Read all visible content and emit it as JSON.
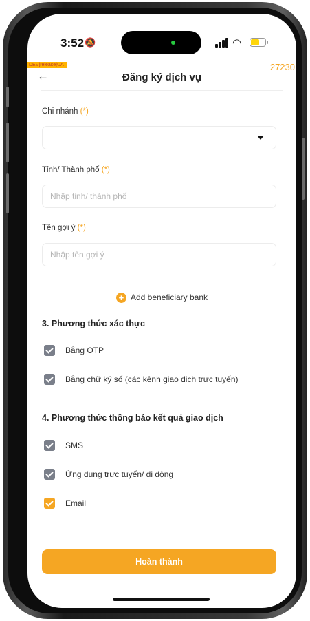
{
  "status": {
    "time": "3:52",
    "bell_icon": "bell-slash-icon",
    "battery_color": "#ffd60a"
  },
  "dev_tag": "DEV|release|UAT",
  "build": "27230",
  "header": {
    "title": "Đăng ký dịch vụ",
    "back_icon": "arrow-left-icon"
  },
  "form": {
    "branch_label": "Chi nhánh",
    "branch_req": "(*)",
    "province_label": "Tỉnh/ Thành phố",
    "province_req": "(*)",
    "province_placeholder": "Nhập tỉnh/ thành phố",
    "suggest_label": "Tên gợi ý",
    "suggest_req": "(*)",
    "suggest_placeholder": "Nhập tên gợi ý"
  },
  "add_bank": "Add beneficiary bank",
  "auth_section": {
    "title": "3. Phương thức xác thực",
    "options": [
      "Bằng OTP",
      "Bằng chữ ký số (các kênh giao dịch trực tuyến)"
    ]
  },
  "notify_section": {
    "title": "4. Phương thức thông báo kết quả giao dịch",
    "options": [
      "SMS",
      "Ứng dụng trực tuyến/ di động",
      "Email"
    ]
  },
  "submit_label": "Hoàn thành",
  "colors": {
    "accent": "#f5a623",
    "checkbox_gray": "#7a7f8a"
  }
}
